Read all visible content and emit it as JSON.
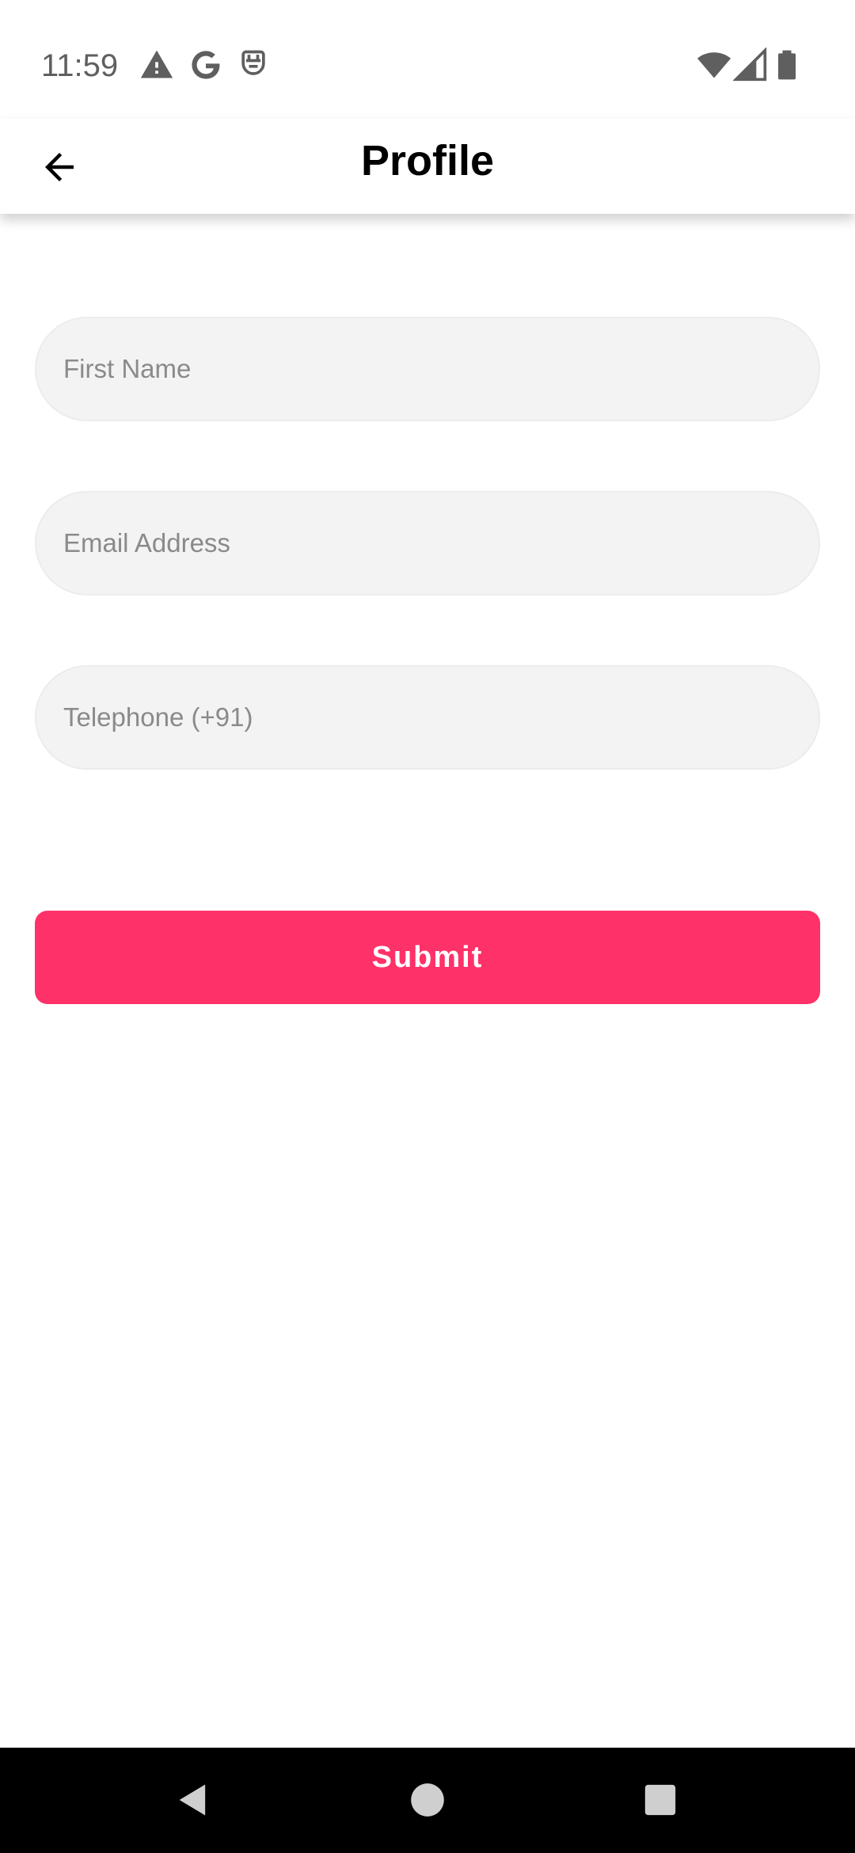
{
  "status_bar": {
    "time": "11:59",
    "left_icons": [
      "warning-icon",
      "google-icon",
      "sim-icon"
    ],
    "right_icons": [
      "wifi-icon",
      "signal-icon",
      "battery-icon"
    ]
  },
  "app_bar": {
    "back_icon": "arrow-left-icon",
    "title": "Profile"
  },
  "form": {
    "first_name": {
      "value": "",
      "placeholder": "First Name"
    },
    "email": {
      "value": "",
      "placeholder": "Email Address"
    },
    "telephone": {
      "value": "",
      "placeholder": "Telephone (+91)"
    },
    "submit_label": "Submit"
  },
  "nav_bar": {
    "buttons": [
      "back-triangle-icon",
      "home-circle-icon",
      "recents-square-icon"
    ]
  },
  "colors": {
    "accent": "#ff3169",
    "field_background": "#f3f3f3",
    "placeholder_text": "#8a8a8a",
    "nav_bar_background": "#000000"
  }
}
